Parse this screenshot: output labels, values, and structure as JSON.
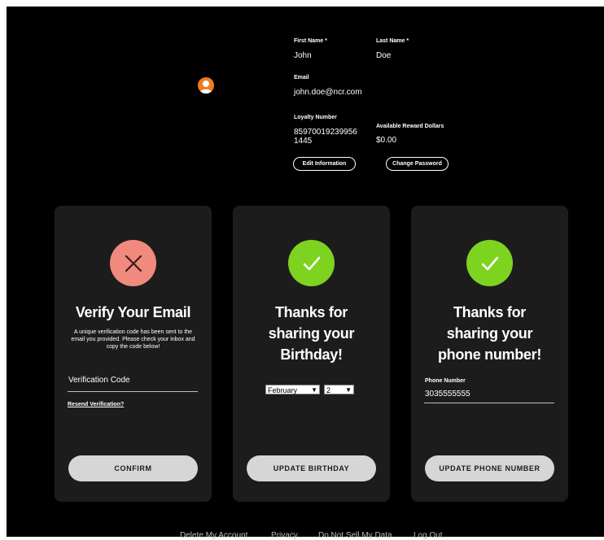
{
  "profile": {
    "first_name_label": "First Name *",
    "first_name_value": "John",
    "last_name_label": "Last Name *",
    "last_name_value": "Doe",
    "email_label": "Email",
    "email_value": "john.doe@ncr.com",
    "loyalty_label": "Loyalty Number",
    "loyalty_value_line1": "85970019239956",
    "loyalty_value_line2": "1445",
    "reward_label": "Available Reward Dollars",
    "reward_value": "$0.00",
    "edit_button": "Edit Information",
    "change_password_button": "Change Password"
  },
  "cards": {
    "email": {
      "title": "Verify Your Email",
      "description": "A unique verification code has been sent to the email you provided. Please check your inbox and copy the code below!",
      "placeholder": "Verification Code",
      "resend_link": "Resend Verification?",
      "button": "CONFIRM"
    },
    "birthday": {
      "title_line1": "Thanks for",
      "title_line2": "sharing your",
      "title_line3": "Birthday!",
      "month": "February",
      "day": "2",
      "button": "UPDATE BIRTHDAY"
    },
    "phone": {
      "title_line1": "Thanks for",
      "title_line2": "sharing your",
      "title_line3": "phone number!",
      "field_label": "Phone Number",
      "field_value": "3035555555",
      "button": "UPDATE PHONE NUMBER"
    }
  },
  "footer": {
    "delete": "Delete My Account",
    "privacy": "Privacy",
    "do_not_sell": "Do Not Sell My Data",
    "logout": "Log Out"
  },
  "colors": {
    "background": "#000000",
    "card": "#1c1c1c",
    "error_badge": "#f08a7e",
    "success_badge": "#7ed321",
    "avatar": "#f07a22",
    "button": "#d6d6d6"
  }
}
